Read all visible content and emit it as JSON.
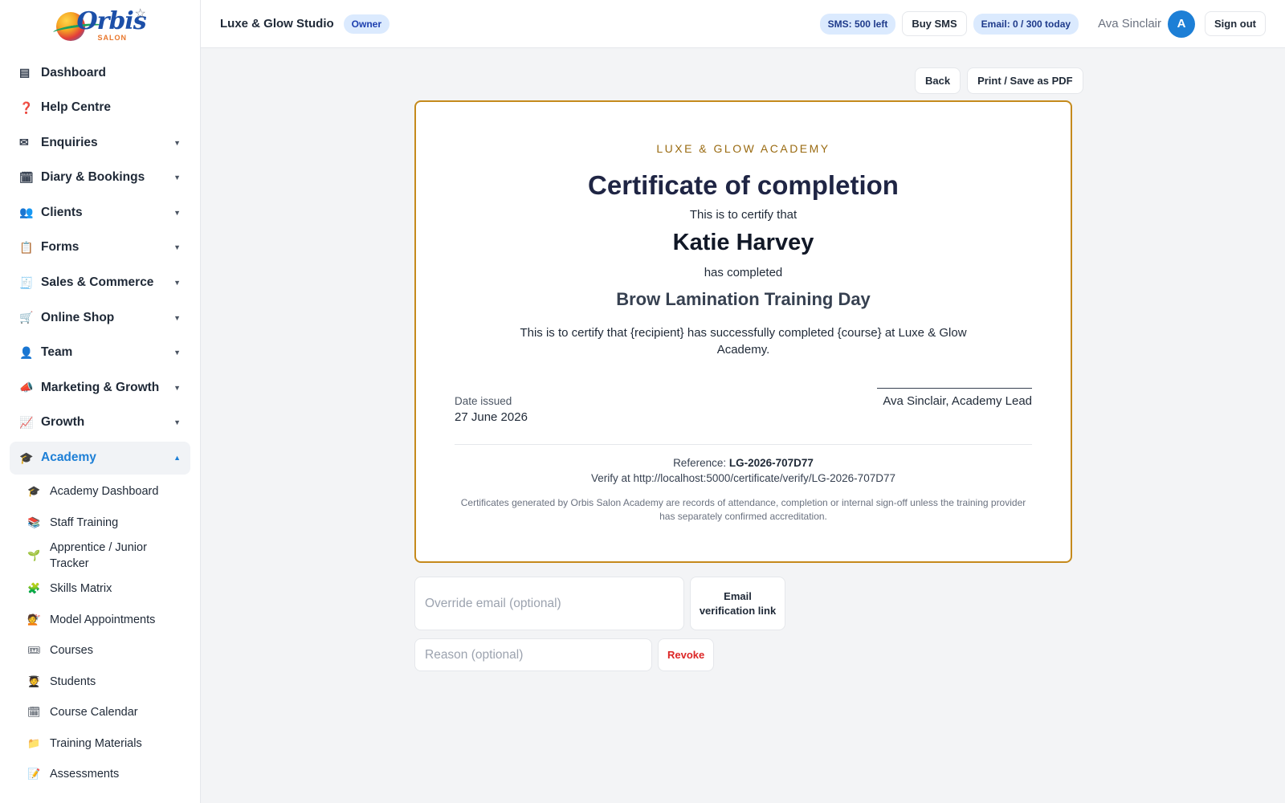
{
  "brand": {
    "logo_text": "Orbis",
    "logo_sub": "SALON"
  },
  "sidebar": {
    "items": [
      {
        "icon": "dashboard-icon",
        "glyph": "▤",
        "label": "Dashboard",
        "caret": ""
      },
      {
        "icon": "help-icon",
        "glyph": "❓",
        "label": "Help Centre",
        "caret": ""
      },
      {
        "icon": "envelope-icon",
        "glyph": "✉",
        "label": "Enquiries",
        "caret": "▼"
      },
      {
        "icon": "calendar-icon",
        "glyph": "🗓",
        "label": "Diary & Bookings",
        "caret": "▼"
      },
      {
        "icon": "people-icon",
        "glyph": "👥",
        "label": "Clients",
        "caret": "▼"
      },
      {
        "icon": "clipboard-icon",
        "glyph": "📋",
        "label": "Forms",
        "caret": "▼"
      },
      {
        "icon": "receipt-icon",
        "glyph": "🧾",
        "label": "Sales & Commerce",
        "caret": "▼"
      },
      {
        "icon": "cart-icon",
        "glyph": "🛒",
        "label": "Online Shop",
        "caret": "▼"
      },
      {
        "icon": "person-icon",
        "glyph": "👤",
        "label": "Team",
        "caret": "▼"
      },
      {
        "icon": "megaphone-icon",
        "glyph": "📣",
        "label": "Marketing & Growth",
        "caret": "▼"
      },
      {
        "icon": "chart-icon",
        "glyph": "📈",
        "label": "Growth",
        "caret": "▼"
      },
      {
        "icon": "graduation-cap-icon",
        "glyph": "🎓",
        "label": "Academy",
        "caret": "▲"
      }
    ],
    "academy_sub": [
      {
        "icon": "graduation-cap-icon",
        "glyph": "🎓",
        "label": "Academy Dashboard"
      },
      {
        "icon": "books-icon",
        "glyph": "📚",
        "label": "Staff Training"
      },
      {
        "icon": "seedling-icon",
        "glyph": "🌱",
        "label": "Apprentice / Junior Tracker"
      },
      {
        "icon": "puzzle-icon",
        "glyph": "🧩",
        "label": "Skills Matrix"
      },
      {
        "icon": "haircut-icon",
        "glyph": "💇",
        "label": "Model Appointments"
      },
      {
        "icon": "ticket-icon",
        "glyph": "🎟",
        "label": "Courses"
      },
      {
        "icon": "student-icon",
        "glyph": "🧑‍🎓",
        "label": "Students"
      },
      {
        "icon": "calendar-icon",
        "glyph": "🗓",
        "label": "Course Calendar"
      },
      {
        "icon": "folder-icon",
        "glyph": "📁",
        "label": "Training Materials"
      },
      {
        "icon": "memo-icon",
        "glyph": "📝",
        "label": "Assessments"
      }
    ]
  },
  "header": {
    "studio": "Luxe & Glow Studio",
    "role": "Owner",
    "sms": "SMS: 500 left",
    "buy_sms": "Buy SMS",
    "email": "Email: 0 / 300 today",
    "user": "Ava Sinclair",
    "avatar": "A",
    "sign_out": "Sign out"
  },
  "actions": {
    "back": "Back",
    "print": "Print / Save as PDF"
  },
  "certificate": {
    "academy": "LUXE & GLOW ACADEMY",
    "title": "Certificate of completion",
    "certify_line": "This is to certify that",
    "recipient": "Katie Harvey",
    "completed_line": "has completed",
    "course": "Brow Lamination Training Day",
    "body": "This is to certify that {recipient} has successfully completed {course} at Luxe & Glow Academy.",
    "date_label": "Date issued",
    "date": "27 June 2026",
    "signatory": "Ava Sinclair, Academy Lead",
    "reference_label": "Reference:",
    "reference": "LG-2026-707D77",
    "verify": "Verify at http://localhost:5000/certificate/verify/LG-2026-707D77",
    "disclaimer": "Certificates generated by Orbis Salon Academy are records of attendance, completion or internal sign-off unless the training provider has separately confirmed accreditation."
  },
  "form": {
    "email_placeholder": "Override email (optional)",
    "email_button": "Email verification link",
    "reason_placeholder": "Reason (optional)",
    "revoke": "Revoke"
  },
  "colors": {
    "accent": "#1d7fd6",
    "border_gold": "#c58a1c",
    "revoke": "#dc2626"
  }
}
